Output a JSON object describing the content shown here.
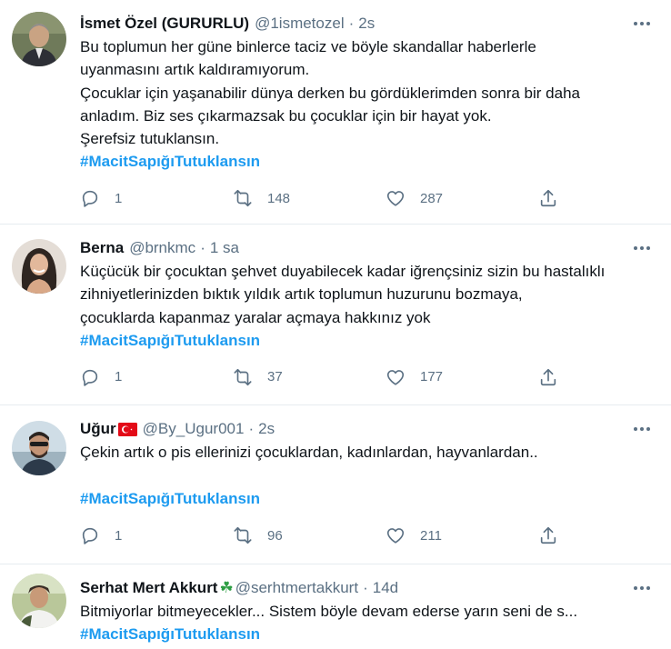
{
  "colors": {
    "accent": "#1d9bf0",
    "muted": "#5b7083",
    "divider": "#e6ecf0",
    "text": "#0f1419"
  },
  "tweets": [
    {
      "name": "İsmet Özel (GURURLU)",
      "handle": "@1ismetozel",
      "separator": "·",
      "time": "2s",
      "text": "Bu toplumun her güne binlerce taciz ve böyle skandallar haberlerle\nuyanmasını artık kaldıramıyorum.\nÇocuklar için yaşanabilir dünya derken bu gördüklerimden sonra bir daha\nanladım. Biz ses çıkarmazsak bu çocuklar için bir hayat yok.\nŞerefsiz tutuklansın.",
      "hashtag": "#MacitSapığıTutuklansın",
      "replies": "1",
      "retweets": "148",
      "likes": "287",
      "icons": [
        "reply-icon",
        "retweet-icon",
        "like-icon",
        "share-icon",
        "more-icon"
      ]
    },
    {
      "name": "Berna",
      "handle": "@brnkmc",
      "separator": "·",
      "time": "1 sa",
      "text": "Küçücük bir çocuktan şehvet duyabilecek kadar iğrençsiniz sizin bu hastalıklı\nzihniyetlerinizden bıktık yıldık artık toplumun huzurunu bozmaya,\nçocuklarda kapanmaz yaralar açmaya hakkınız yok",
      "hashtag": "#MacitSapığıTutuklansın",
      "replies": "1",
      "retweets": "37",
      "likes": "177"
    },
    {
      "name": "Uğur",
      "handle": "@By_Ugur001",
      "separator": "·",
      "time": "2s",
      "text": "Çekin artık o pis ellerinizi çocuklardan, kadınlardan, hayvanlardan..",
      "hashtag": "#MacitSapığıTutuklansın",
      "replies": "1",
      "retweets": "96",
      "likes": "211",
      "badge": "turkey-flag-icon"
    },
    {
      "name": "Serhat Mert Akkurt",
      "handle": "@serhtmertakkurt",
      "separator": "·",
      "time": "14d",
      "text": "Bitmiyorlar bitmeyecekler... Sistem böyle devam ederse yarın seni de s...",
      "hashtag": "#MacitSapığıTutuklansın",
      "badge": "clover-icon",
      "badge_glyph": "☘"
    }
  ]
}
